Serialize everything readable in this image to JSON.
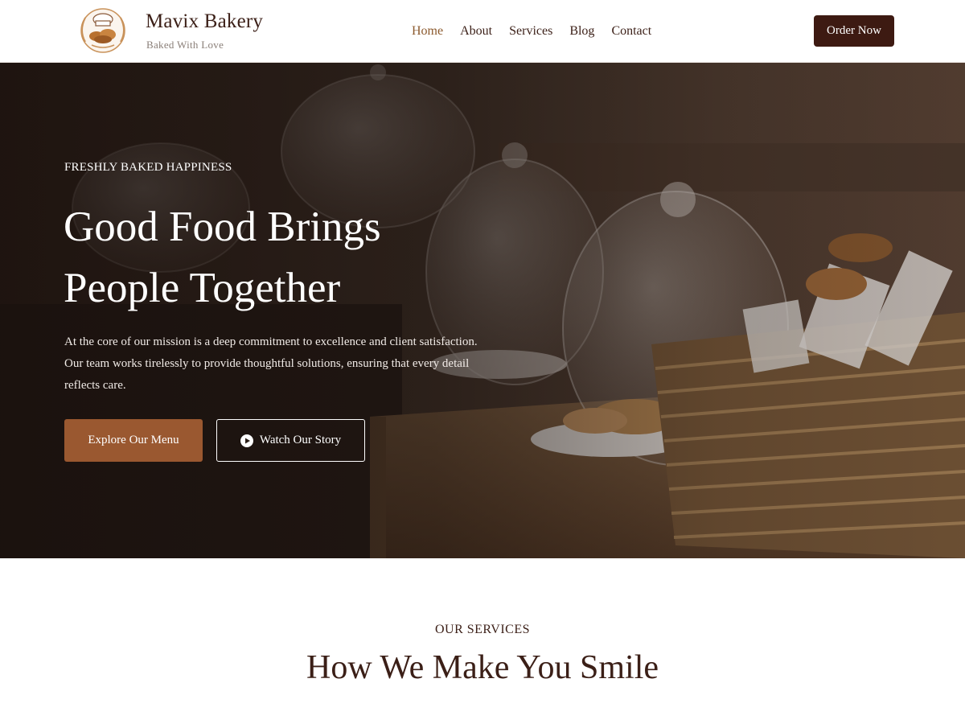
{
  "header": {
    "brand_name": "Mavix Bakery",
    "brand_tagline": "Baked With Love",
    "logo_icon": "chef-hat-bread-logo",
    "nav": [
      {
        "label": "Home",
        "active": true
      },
      {
        "label": "About",
        "active": false
      },
      {
        "label": "Services",
        "active": false
      },
      {
        "label": "Blog",
        "active": false
      },
      {
        "label": "Contact",
        "active": false
      }
    ],
    "cta_label": "Order Now"
  },
  "hero": {
    "eyebrow": "FRESHLY BAKED HAPPINESS",
    "title_line1": "Good Food Brings",
    "title_line2": "People Together",
    "description": "At the core of our mission is a deep commitment to excellence and client satisfaction. Our team works tirelessly to provide thoughtful solutions, ensuring that every detail reflects care.",
    "primary_button": "Explore Our Menu",
    "secondary_button": "Watch Our Story",
    "secondary_icon": "play-circle-icon",
    "background_image": "bakery-counter-with-glass-cloches-and-wicker-basket"
  },
  "services": {
    "eyebrow": "OUR SERVICES",
    "title": "How We Make You Smile"
  },
  "colors": {
    "primary_dark": "#3d1a12",
    "accent": "#9a5830",
    "nav_active": "#8c5a2e",
    "text": "#3b1f17"
  }
}
